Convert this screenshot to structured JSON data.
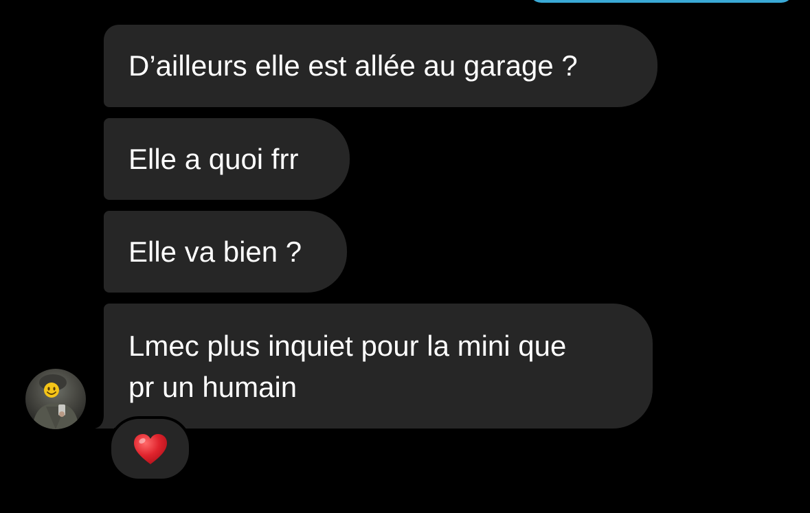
{
  "messages": [
    {
      "text": "D’ailleurs elle est allée au garage ?"
    },
    {
      "text": "Elle a quoi frr"
    },
    {
      "text": "Elle va bien ?"
    },
    {
      "lines": [
        "Lmec plus inquiet pour la mini que",
        "pr un humain"
      ]
    }
  ],
  "reaction": {
    "icon": "red-heart-icon"
  },
  "avatar": {
    "icon": "smiley-face-icon"
  },
  "colors": {
    "background": "#000000",
    "incoming_bubble": "#262626",
    "outgoing_bubble": "#3aa9d6",
    "heart": "#e0242d"
  }
}
